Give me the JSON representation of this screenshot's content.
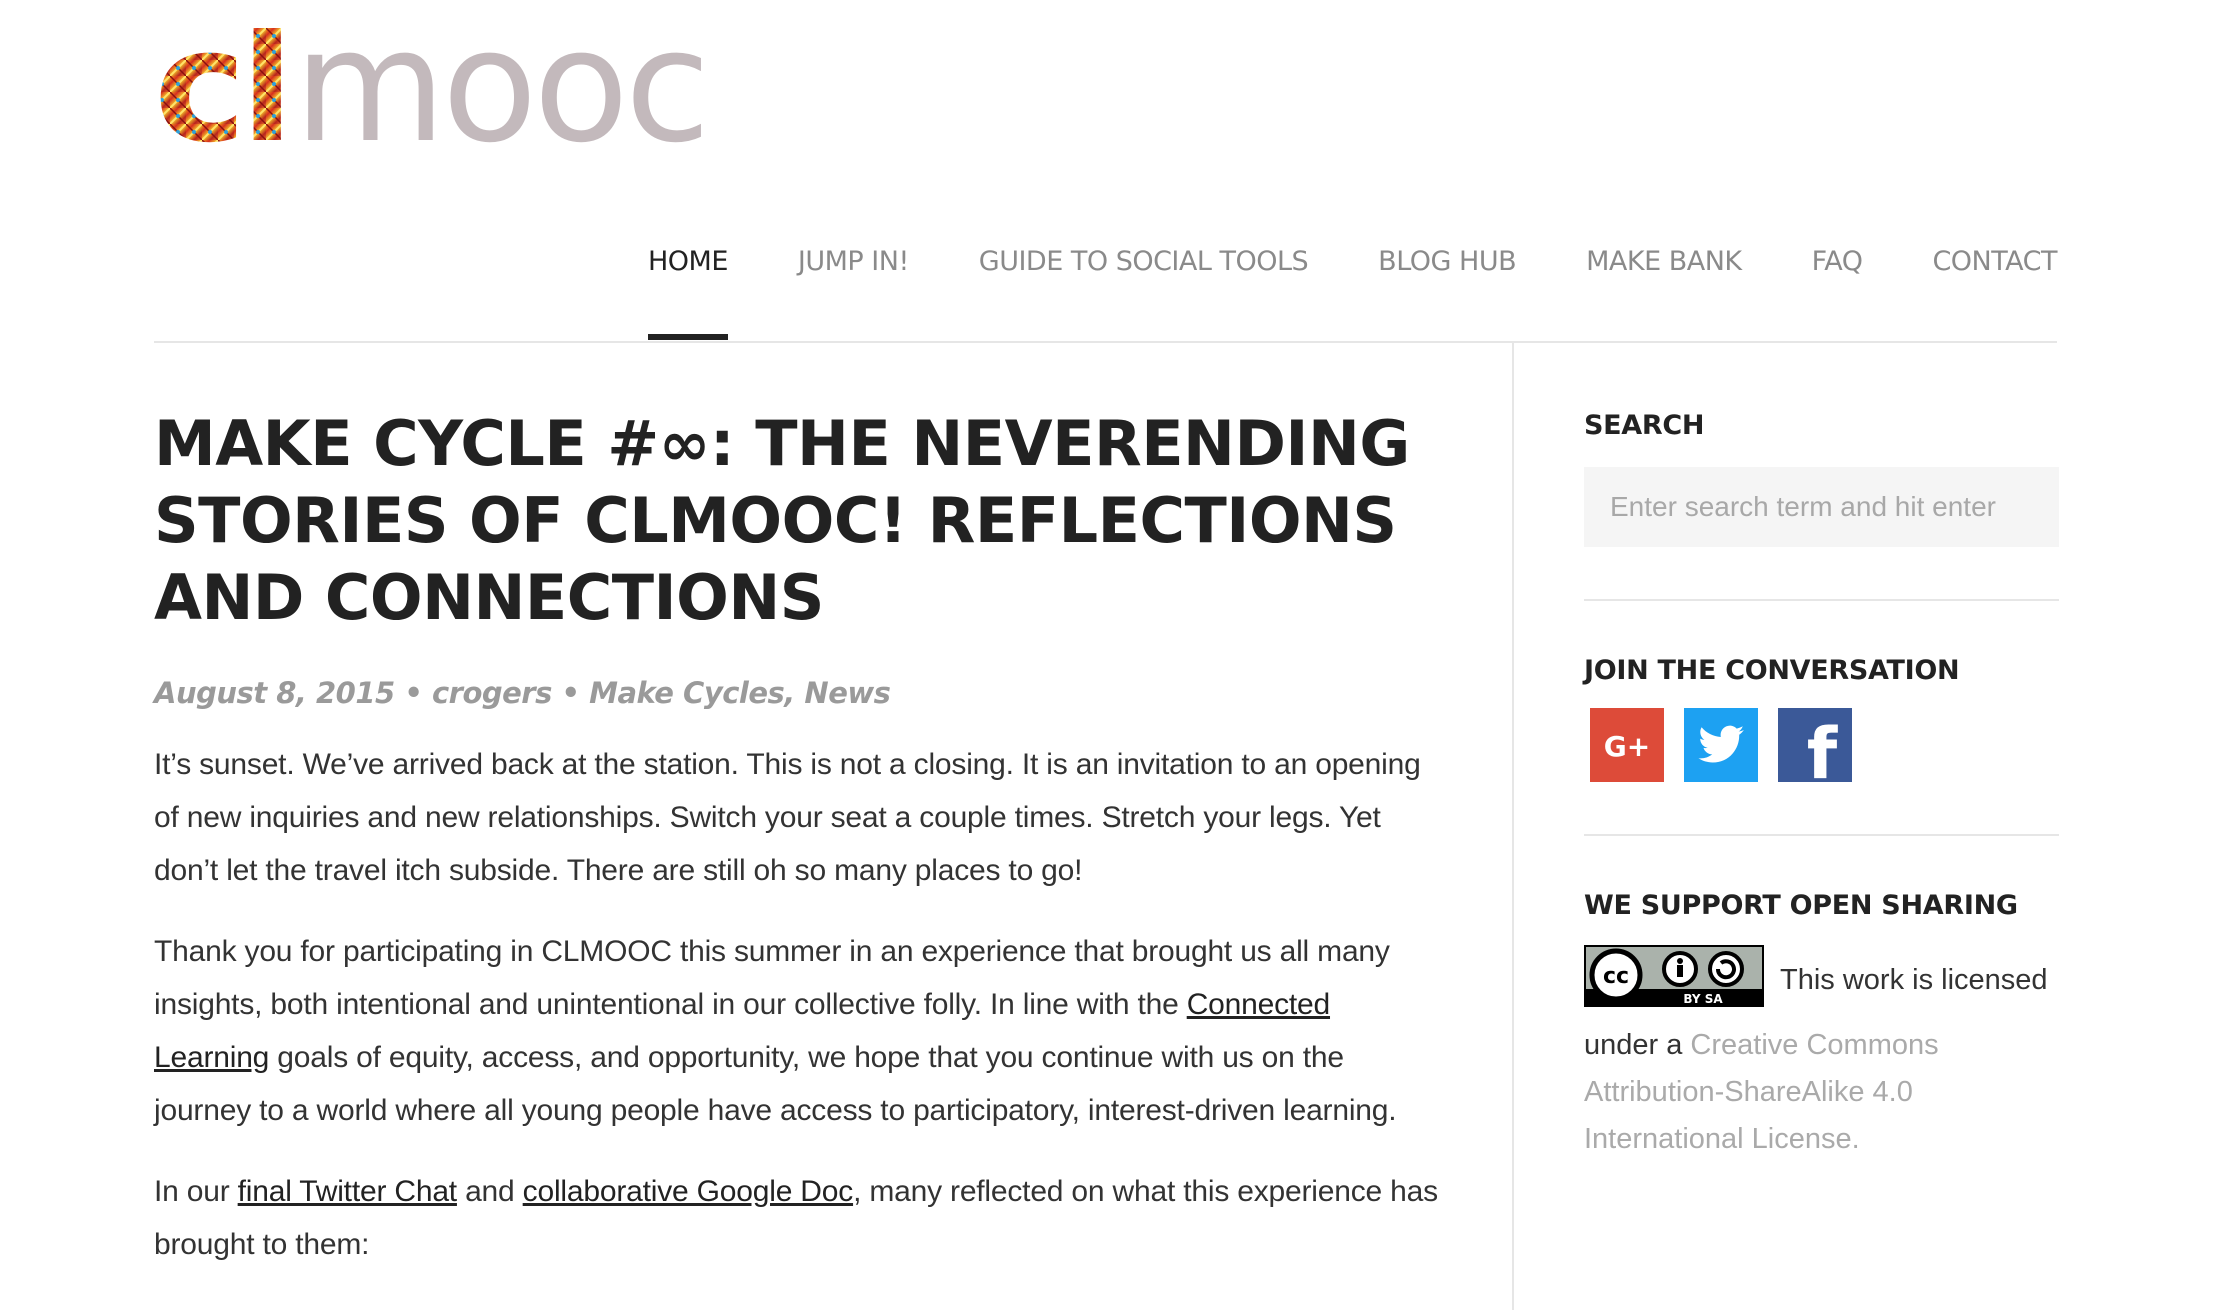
{
  "logo": {
    "text_part1": "cl",
    "text_part2": "mooc"
  },
  "nav": {
    "items": [
      {
        "label": "HOME",
        "active": true
      },
      {
        "label": "JUMP IN!",
        "active": false
      },
      {
        "label": "GUIDE TO SOCIAL TOOLS",
        "active": false
      },
      {
        "label": "BLOG HUB",
        "active": false
      },
      {
        "label": "MAKE BANK",
        "active": false
      },
      {
        "label": "FAQ",
        "active": false
      },
      {
        "label": "CONTACT",
        "active": false
      }
    ]
  },
  "post": {
    "title": "MAKE CYCLE #∞: THE NEVERENDING STORIES OF CLMOOC! REFLECTIONS AND CONNECTIONS",
    "meta": {
      "date": "August 8, 2015",
      "author": "crogers",
      "categories": [
        "Make Cycles",
        "News"
      ],
      "separator": " • "
    },
    "paragraphs": {
      "p1": "It’s sunset. We’ve arrived back at the station. This is not a closing. It is an invitation to an opening of new inquiries and new relationships. Switch your seat a couple times. Stretch your legs. Yet don’t let the travel itch subside. There are still oh so many places to go!",
      "p2_before": "Thank you for participating in CLMOOC this summer in an experience that brought us all many insights, both intentional and unintentional in our collective folly. In line with the ",
      "p2_link": "Connected Learning",
      "p2_after": " goals of equity, access, and opportunity, we hope that you continue with us on the journey to a world where all young people have access to participatory, interest-driven learning.",
      "p3_before": "In our ",
      "p3_link1": "final Twitter Chat",
      "p3_mid": " and ",
      "p3_link2": "collaborative Google Doc",
      "p3_after": ", many reflected on what this experience has brought to them:"
    }
  },
  "sidebar": {
    "search": {
      "title": "SEARCH",
      "placeholder": "Enter search term and hit enter"
    },
    "social": {
      "title": "JOIN THE CONVERSATION",
      "icons": [
        {
          "name": "google-plus",
          "color": "#dd4b39",
          "glyph": "G+"
        },
        {
          "name": "twitter",
          "color": "#1da1f2"
        },
        {
          "name": "facebook",
          "color": "#3b5998",
          "glyph": "f"
        }
      ]
    },
    "license": {
      "title": "WE SUPPORT OPEN SHARING",
      "badge_text": "BY SA",
      "text_before": "This work is licensed under a ",
      "link": "Creative Commons Attribution-ShareAlike 4.0 International License."
    }
  }
}
